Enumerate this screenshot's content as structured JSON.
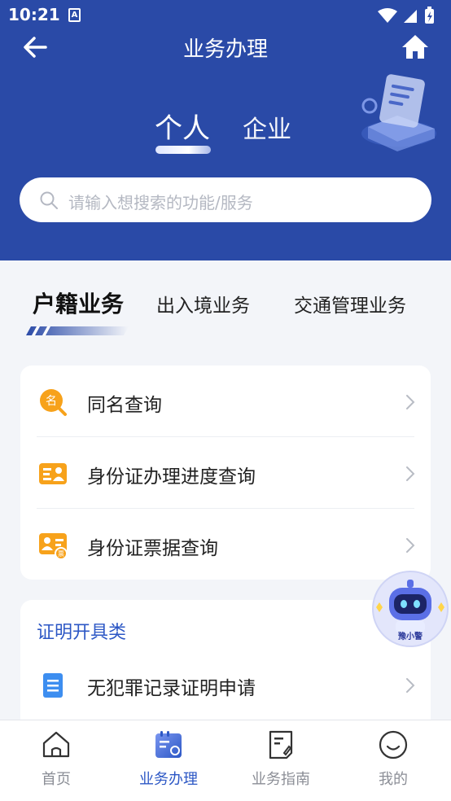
{
  "status_bar": {
    "time": "10:21",
    "app_icon_letter": "A"
  },
  "nav": {
    "title": "业务办理"
  },
  "segments": {
    "personal": "个人",
    "enterprise": "企业"
  },
  "search": {
    "placeholder": "请输入想搜索的功能/服务"
  },
  "category_tabs": [
    "户籍业务",
    "出入境业务",
    "交通管理业务"
  ],
  "card_1_items": [
    {
      "label": "同名查询",
      "icon": "name-search-icon"
    },
    {
      "label": "身份证办理进度查询",
      "icon": "id-card-progress-icon"
    },
    {
      "label": "身份证票据查询",
      "icon": "id-card-receipt-icon"
    }
  ],
  "card_2": {
    "section_title": "证明开具类",
    "items": [
      {
        "label": "无犯罪记录证明申请",
        "icon": "document-icon"
      }
    ]
  },
  "assistant": {
    "badge_text": "豫小警"
  },
  "bottom_nav": [
    {
      "label": "首页",
      "icon": "home-icon",
      "active": false
    },
    {
      "label": "业务办理",
      "icon": "business-icon",
      "active": true
    },
    {
      "label": "业务指南",
      "icon": "guide-icon",
      "active": false
    },
    {
      "label": "我的",
      "icon": "profile-icon",
      "active": false
    }
  ],
  "colors": {
    "header_bg": "#2a4aa7",
    "accent": "#2c57c5",
    "icon_orange": "#f7a21b",
    "icon_blue": "#3d8ef0"
  }
}
